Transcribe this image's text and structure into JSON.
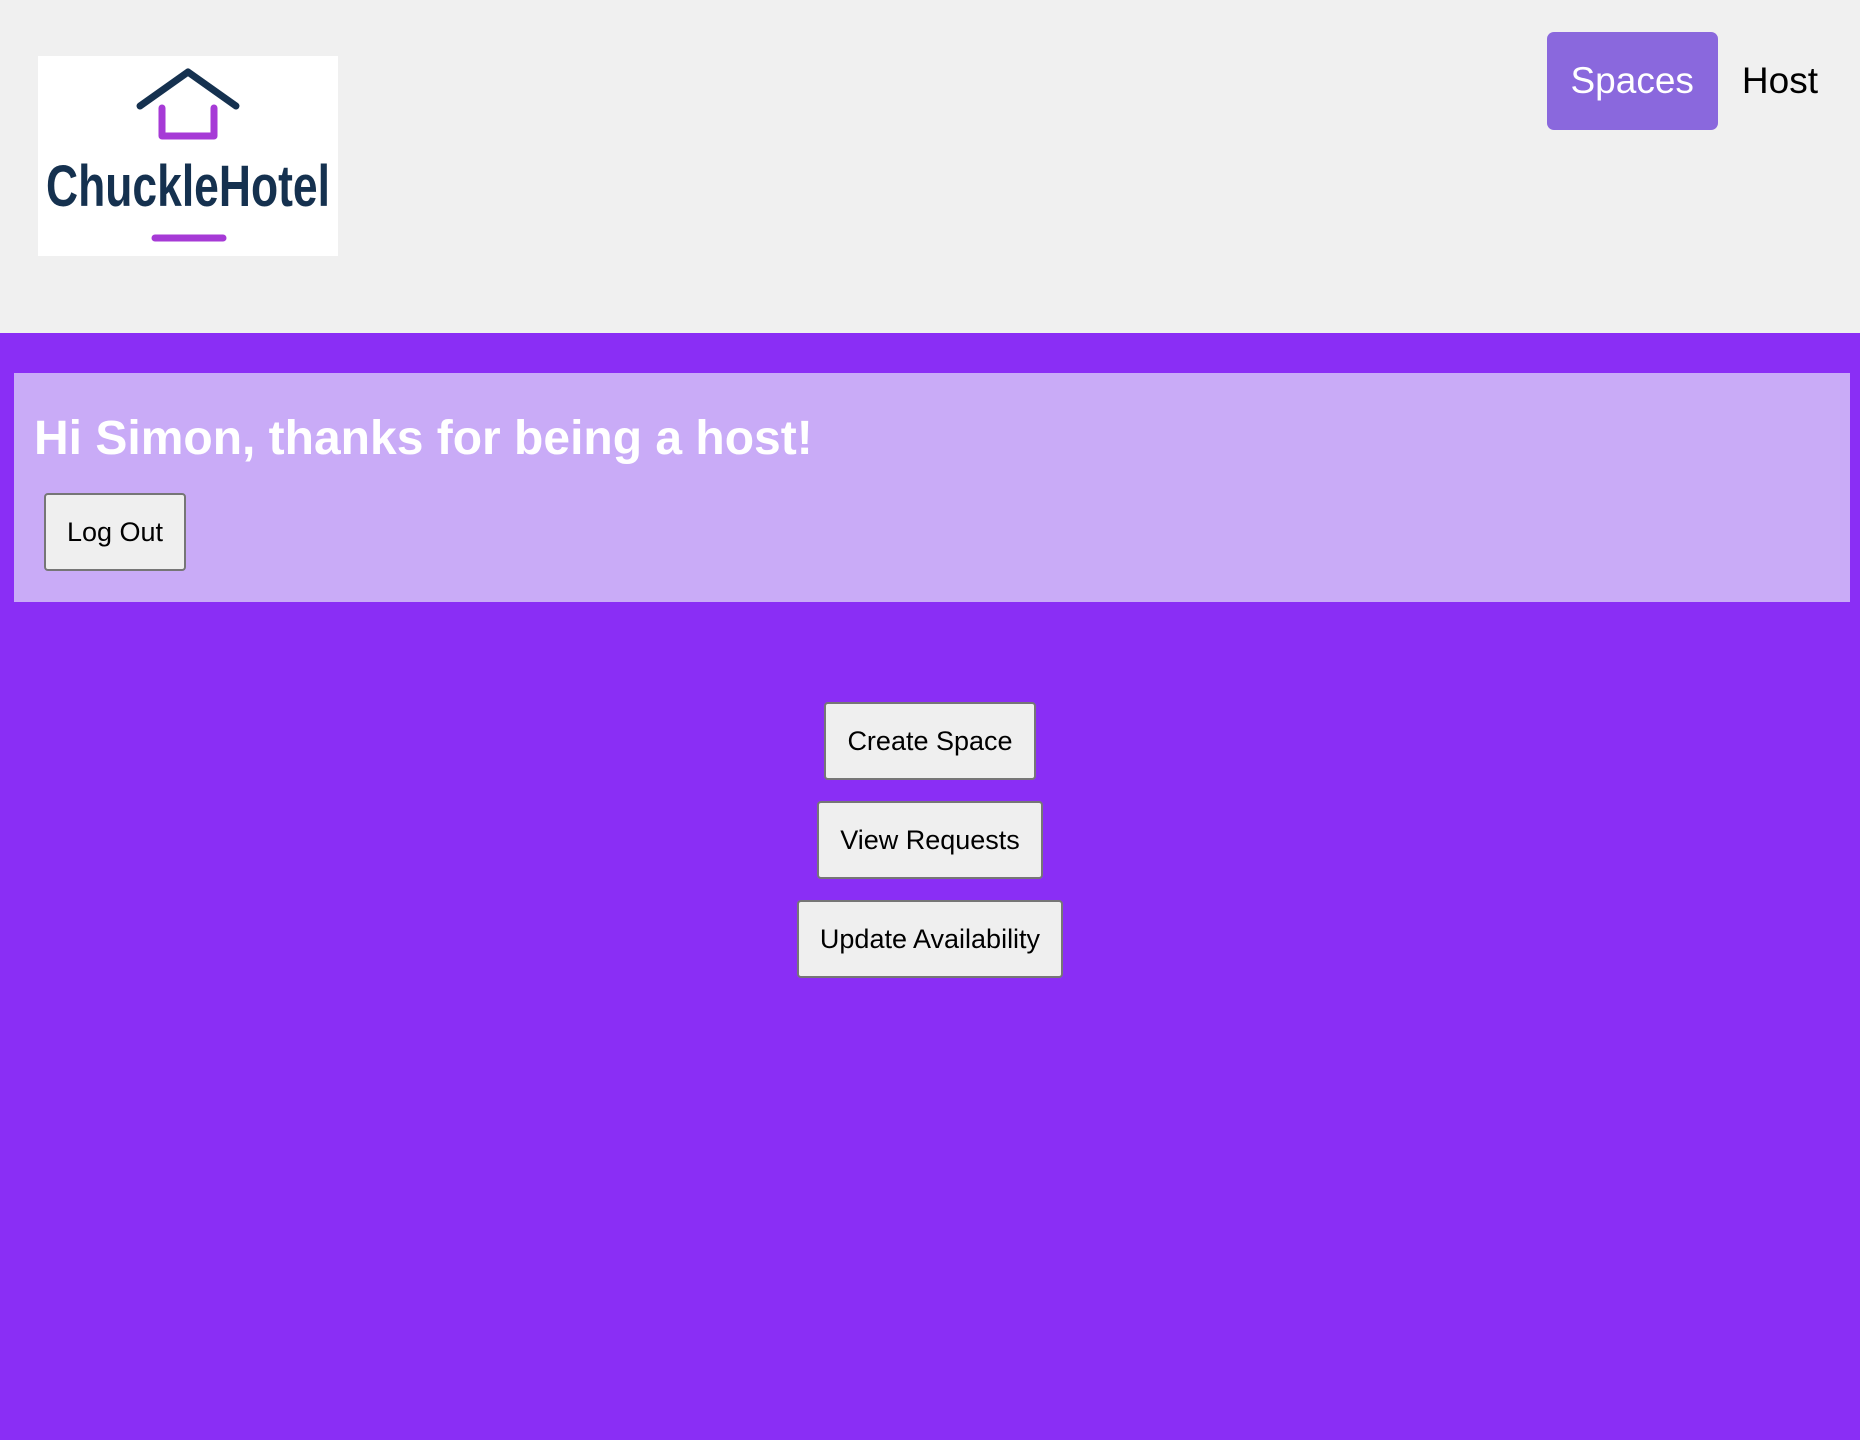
{
  "brand": {
    "logo_text": "ChuckleHotel"
  },
  "nav": {
    "items": [
      {
        "label": "Spaces",
        "active": true
      },
      {
        "label": "Host",
        "active": false
      }
    ]
  },
  "welcome": {
    "greeting": "Hi Simon, thanks for being a host!",
    "logout_label": "Log Out"
  },
  "actions": {
    "create_label": "Create Space",
    "requests_label": "View Requests",
    "availability_label": "Update Availability"
  },
  "colors": {
    "page_bg": "#8a2ef5",
    "header_bg": "#f0f0f0",
    "welcome_bg": "#c9abf7",
    "nav_active_bg": "#8a68dd",
    "logo_navy": "#15314f",
    "logo_purple": "#a63ad6"
  }
}
